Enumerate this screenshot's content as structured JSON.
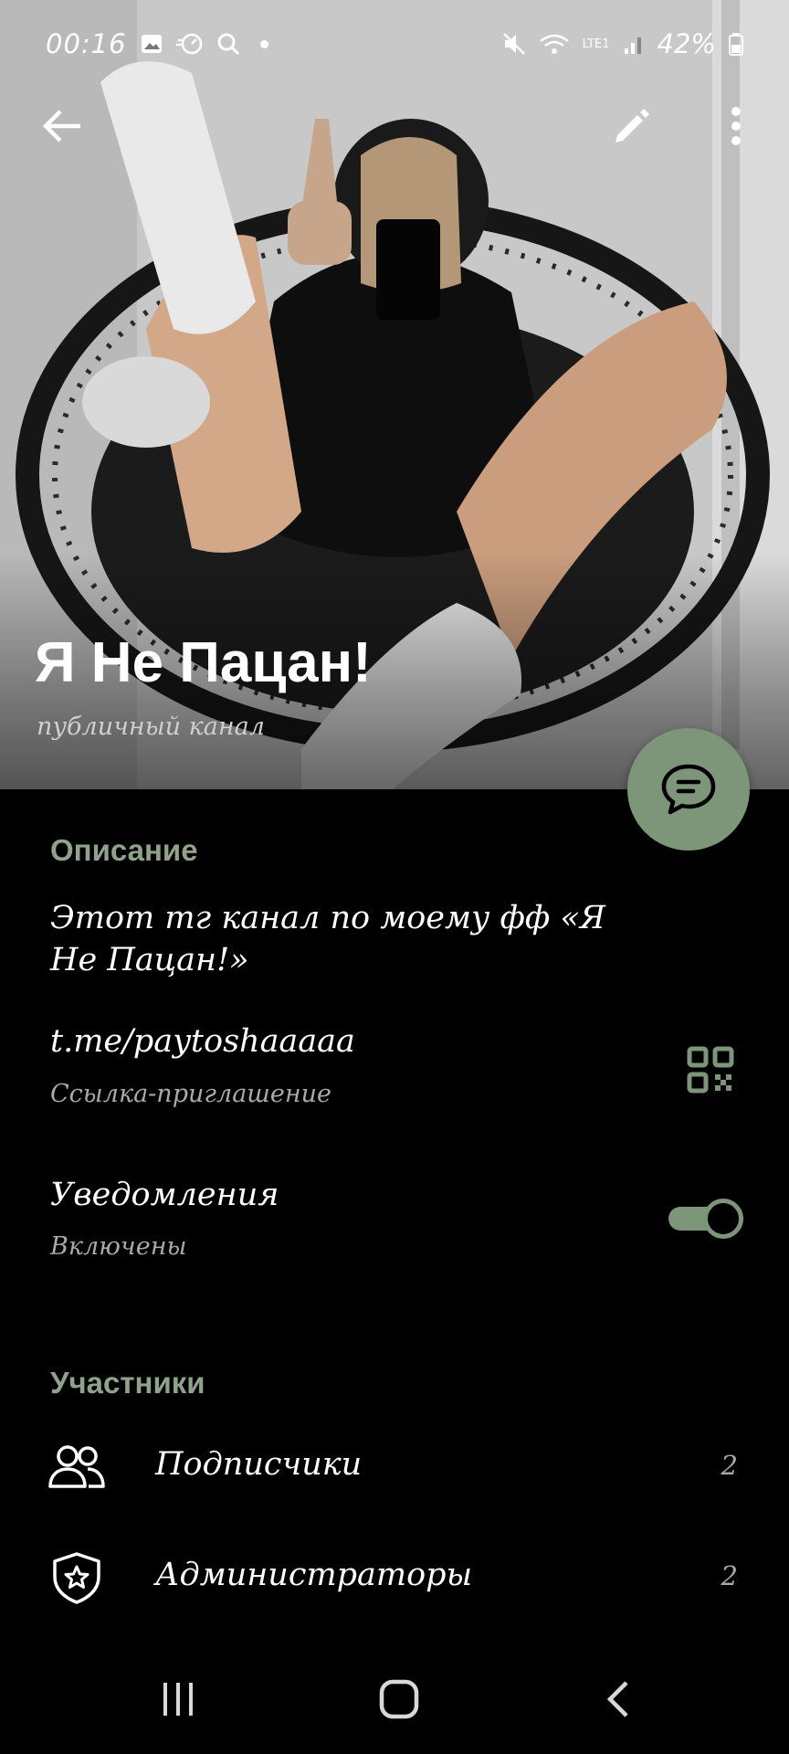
{
  "status_bar": {
    "time": "00:16",
    "battery": "42%",
    "network": "LTE1",
    "icons": [
      "image-icon",
      "speed-icon",
      "search-icon",
      "mute-icon",
      "wifi-icon",
      "signal-icon",
      "battery-icon"
    ]
  },
  "channel": {
    "name": "Я Не Пацан!",
    "type": "публичный канал"
  },
  "description": {
    "title": "Описание",
    "text": "Этот тг канал по моему фф «Я Не Пацан!»"
  },
  "invite": {
    "link": "t.me/paytoshaaaaa",
    "caption": "Ссылка-приглашение"
  },
  "notifications": {
    "label": "Уведомления",
    "state": "Включены",
    "enabled": true
  },
  "members": {
    "title": "Участники",
    "rows": [
      {
        "label": "Подписчики",
        "count": "2",
        "icon": "people-icon"
      },
      {
        "label": "Администраторы",
        "count": "2",
        "icon": "admin-shield-icon"
      }
    ]
  },
  "colors": {
    "accent": "#7d9578",
    "section": "#8fa38a",
    "background": "#000000"
  }
}
